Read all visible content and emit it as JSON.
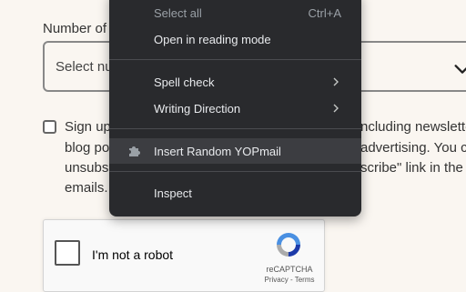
{
  "form": {
    "number_label": "Number of",
    "select_placeholder": "Select nu",
    "consent_lines_left": [
      "Sign up",
      "blog po",
      "unsubs",
      "emails."
    ],
    "consent_lines_right": [
      "ncluding newslette",
      "advertising. You c",
      "scribe\" link in the"
    ]
  },
  "recaptcha": {
    "label": "I'm not a robot",
    "brand": "reCAPTCHA",
    "terms": "Privacy - Terms"
  },
  "context_menu": {
    "select_all": "Select all",
    "select_all_shortcut": "Ctrl+A",
    "reading_mode": "Open in reading mode",
    "spell_check": "Spell check",
    "writing_direction": "Writing Direction",
    "insert_yopmail": "Insert Random YOPmail",
    "inspect": "Inspect"
  },
  "colors": {
    "menu_bg": "#292a2d",
    "menu_hover": "#3c3d41",
    "page_bg": "#faf6f1"
  }
}
